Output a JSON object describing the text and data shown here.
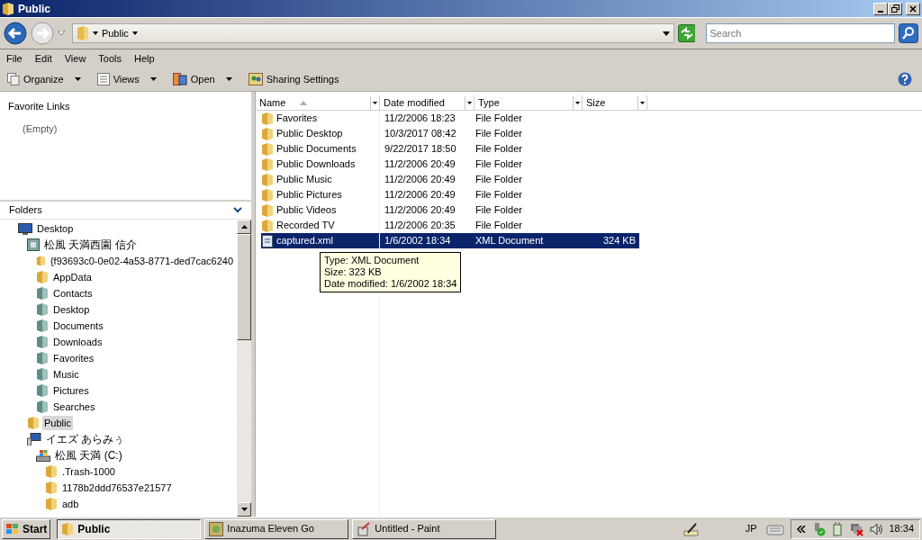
{
  "window": {
    "title": "Public"
  },
  "address": {
    "crumbs": [
      "Public"
    ]
  },
  "search": {
    "placeholder": "Search"
  },
  "menu": [
    "File",
    "Edit",
    "View",
    "Tools",
    "Help"
  ],
  "toolbar": [
    {
      "label": "Organize",
      "kind": "organize",
      "dropdown": true
    },
    {
      "label": "Views",
      "kind": "views",
      "dropdown": true
    },
    {
      "label": "Open",
      "kind": "open",
      "dropdown": true
    },
    {
      "label": "Sharing Settings",
      "kind": "share",
      "dropdown": false
    }
  ],
  "favorites": {
    "title": "Favorite Links",
    "empty": "(Empty)"
  },
  "folders": {
    "title": "Folders",
    "tree": [
      {
        "label": "Desktop",
        "kind": "desktop",
        "selected": false,
        "children": [
          {
            "label": "松風  天満西園  信介",
            "kind": "user",
            "selected": false,
            "children": [
              {
                "label": "{f93693c0-0e02-4a53-8771-ded7cac6240",
                "kind": "folder",
                "selected": false
              },
              {
                "label": "AppData",
                "kind": "folder",
                "selected": false
              },
              {
                "label": "Contacts",
                "kind": "special",
                "selected": false
              },
              {
                "label": "Desktop",
                "kind": "special",
                "selected": false
              },
              {
                "label": "Documents",
                "kind": "special",
                "selected": false
              },
              {
                "label": "Downloads",
                "kind": "special",
                "selected": false
              },
              {
                "label": "Favorites",
                "kind": "special",
                "selected": false
              },
              {
                "label": "Music",
                "kind": "special",
                "selected": false
              },
              {
                "label": "Pictures",
                "kind": "special",
                "selected": false
              },
              {
                "label": "Searches",
                "kind": "special",
                "selected": false
              }
            ]
          },
          {
            "label": "Public",
            "kind": "folder",
            "selected": true
          },
          {
            "label": "イエズ  あらみぅ",
            "kind": "computer",
            "selected": false,
            "children": [
              {
                "label": "松風  天満 (C:)",
                "kind": "drive",
                "selected": false,
                "children": [
                  {
                    "label": ".Trash-1000",
                    "kind": "folder",
                    "selected": false
                  },
                  {
                    "label": "1178b2ddd76537e21577",
                    "kind": "folder",
                    "selected": false
                  },
                  {
                    "label": "adb",
                    "kind": "folder",
                    "selected": false
                  }
                ]
              }
            ]
          }
        ]
      }
    ]
  },
  "table": {
    "columns": [
      {
        "label": "Name",
        "sorted": true
      },
      {
        "label": "Date modified",
        "sorted": false
      },
      {
        "label": "Type",
        "sorted": false
      },
      {
        "label": "Size",
        "sorted": false
      }
    ],
    "rows": [
      {
        "name": "Favorites",
        "date": "11/2/2006 18:23",
        "type": "File Folder",
        "kind": "folder",
        "selected": false
      },
      {
        "name": "Public Desktop",
        "date": "10/3/2017 08:42",
        "type": "File Folder",
        "kind": "folder",
        "selected": false
      },
      {
        "name": "Public Documents",
        "date": "9/22/2017 18:50",
        "type": "File Folder",
        "kind": "folder",
        "selected": false
      },
      {
        "name": "Public Downloads",
        "date": "11/2/2006 20:49",
        "type": "File Folder",
        "kind": "folder",
        "selected": false
      },
      {
        "name": "Public Music",
        "date": "11/2/2006 20:49",
        "type": "File Folder",
        "kind": "folder",
        "selected": false
      },
      {
        "name": "Public Pictures",
        "date": "11/2/2006 20:49",
        "type": "File Folder",
        "kind": "folder",
        "selected": false
      },
      {
        "name": "Public Videos",
        "date": "11/2/2006 20:49",
        "type": "File Folder",
        "kind": "folder",
        "selected": false
      },
      {
        "name": "Recorded TV",
        "date": "11/2/2006 20:35",
        "type": "File Folder",
        "kind": "folder",
        "selected": false
      },
      {
        "name": "captured.xml",
        "date": "1/6/2002 18:34",
        "type": "XML Document",
        "size": "324 KB",
        "kind": "file",
        "selected": true
      }
    ]
  },
  "tooltip": [
    "Type: XML Document",
    "Size: 323 KB",
    "Date modified: 1/6/2002 18:34"
  ],
  "taskbar": {
    "start": "Start",
    "items": [
      {
        "label": "Public",
        "kind": "folder",
        "selected": true
      },
      {
        "label": "Inazuma Eleven Go",
        "kind": "game",
        "selected": false
      },
      {
        "label": "Untitled - Paint",
        "kind": "paint",
        "selected": false
      }
    ],
    "language": "JP",
    "clock": "18:34"
  }
}
